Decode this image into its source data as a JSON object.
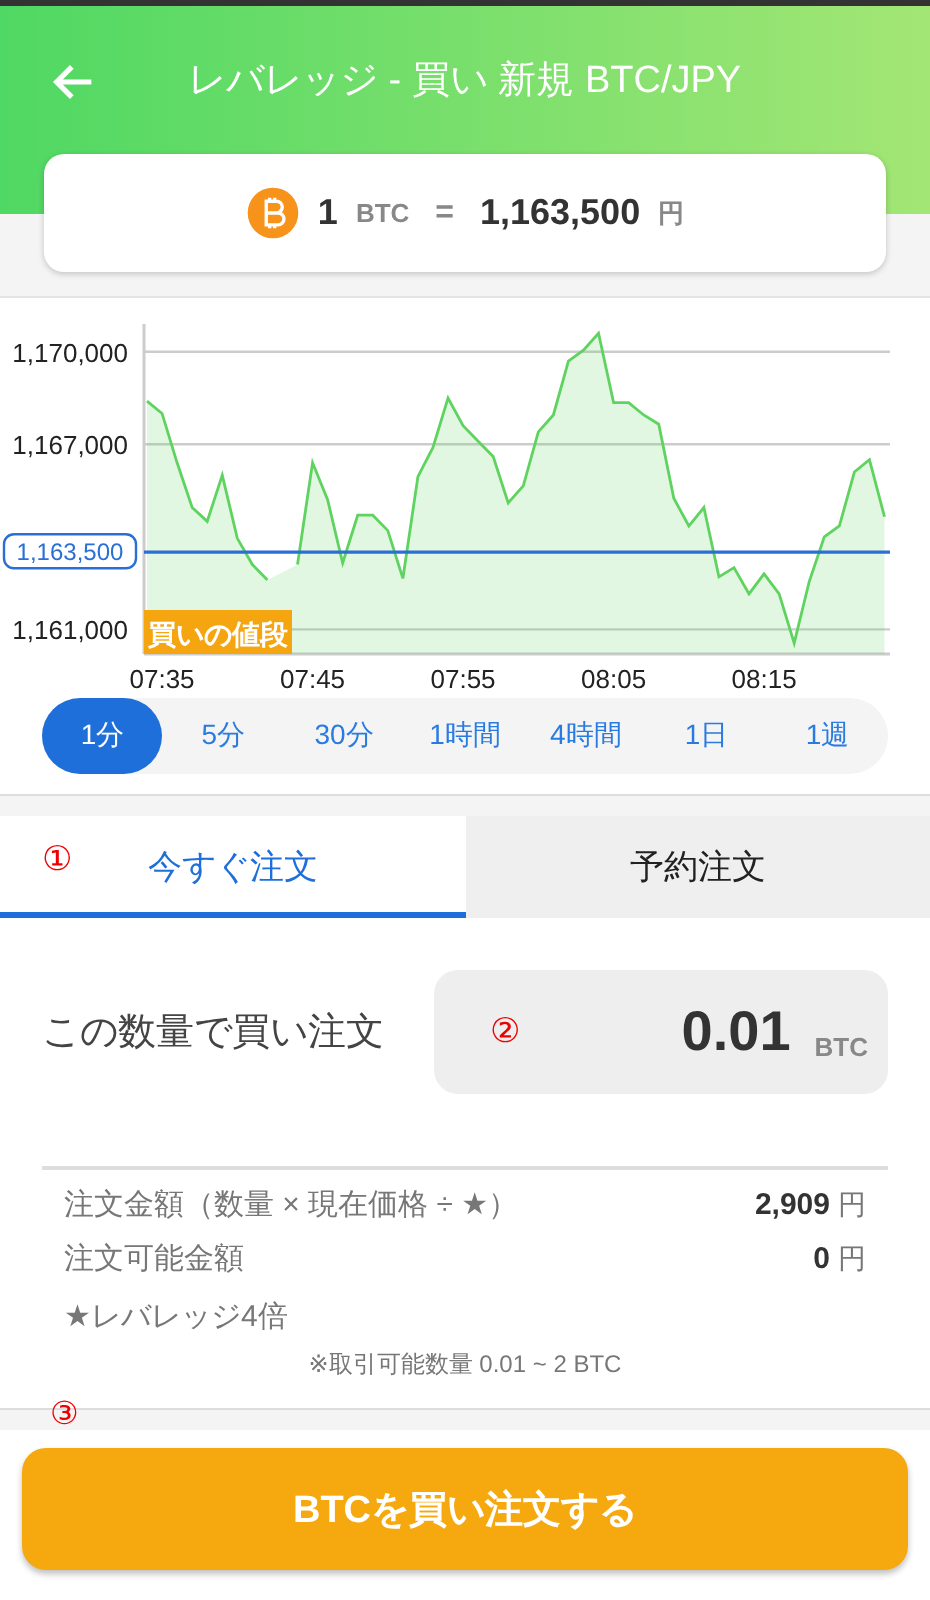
{
  "header": {
    "title": "レバレッジ - 買い 新規 BTC/JPY"
  },
  "rate": {
    "amount": "1",
    "unit": "BTC",
    "equals": "=",
    "price": "1,163,500",
    "currency": "円"
  },
  "chart": {
    "chart_data": {
      "type": "area",
      "grid": true,
      "categories": [
        null,
        "07:35",
        null,
        null,
        null,
        null,
        null,
        null,
        null,
        null,
        null,
        "07:45",
        null,
        null,
        null,
        null,
        null,
        null,
        null,
        null,
        null,
        "07:55",
        null,
        null,
        null,
        null,
        null,
        null,
        null,
        null,
        null,
        "08:05",
        null,
        null,
        null,
        null,
        null,
        null,
        null,
        null,
        null,
        "08:15",
        null,
        null,
        null,
        null,
        null,
        null,
        null,
        null
      ],
      "series": [
        {
          "color": "#5fd35f",
          "values": [
            1168400,
            1168000,
            1166400,
            1164950,
            1164500,
            1166000,
            1163950,
            1163100,
            1162600,
            null,
            1163100,
            1166400,
            1165200,
            1163150,
            1164700,
            1164700,
            1164200,
            1162650,
            1165950,
            1166900,
            1168500,
            1167600,
            1167100,
            1166600,
            1165100,
            1165650,
            1167400,
            1167950,
            1169700,
            1170050,
            1170600,
            1168350,
            1168350,
            1167950,
            1167650,
            1165250,
            1164350,
            1164950,
            1162700,
            1163000,
            1162150,
            1162800,
            1162150,
            1160550,
            1162550,
            1164000,
            1164350,
            1166100,
            1166500,
            1164650
          ]
        }
      ],
      "ylim": [
        1160200,
        1170900
      ],
      "yticks": [
        {
          "value": 1161000,
          "label": "1,161,000"
        },
        {
          "value": 1167000,
          "label": "1,167,000"
        },
        {
          "value": 1170000,
          "label": "1,170,000"
        }
      ],
      "ref_lines": [
        {
          "axis": "y",
          "value": 1163500,
          "label": "1,163,500"
        }
      ],
      "annotations": [
        {
          "text": "買いの値段"
        }
      ]
    }
  },
  "intervals": [
    {
      "label": "1分",
      "selected": true
    },
    {
      "label": "5分",
      "selected": false
    },
    {
      "label": "30分",
      "selected": false
    },
    {
      "label": "1時間",
      "selected": false
    },
    {
      "label": "4時間",
      "selected": false
    },
    {
      "label": "1日",
      "selected": false
    },
    {
      "label": "1週",
      "selected": false
    }
  ],
  "tabs": [
    {
      "label": "今すぐ注文",
      "selected": true,
      "marker": "①"
    },
    {
      "label": "予約注文",
      "selected": false
    }
  ],
  "quantity": {
    "label": "この数量で買い注文",
    "marker": "②",
    "value": "0.01",
    "unit": "BTC"
  },
  "summary": [
    {
      "label": "注文金額（数量 × 現在価格 ÷ ★）",
      "value": "2,909",
      "unit": "円"
    },
    {
      "label": "注文可能金額",
      "value": "0",
      "unit": "円"
    }
  ],
  "leverage_note": "★レバレッジ4倍",
  "range_note": "※取引可能数量 0.01 ~ 2 BTC",
  "submit": {
    "marker": "③",
    "label": "BTCを買い注文する"
  }
}
